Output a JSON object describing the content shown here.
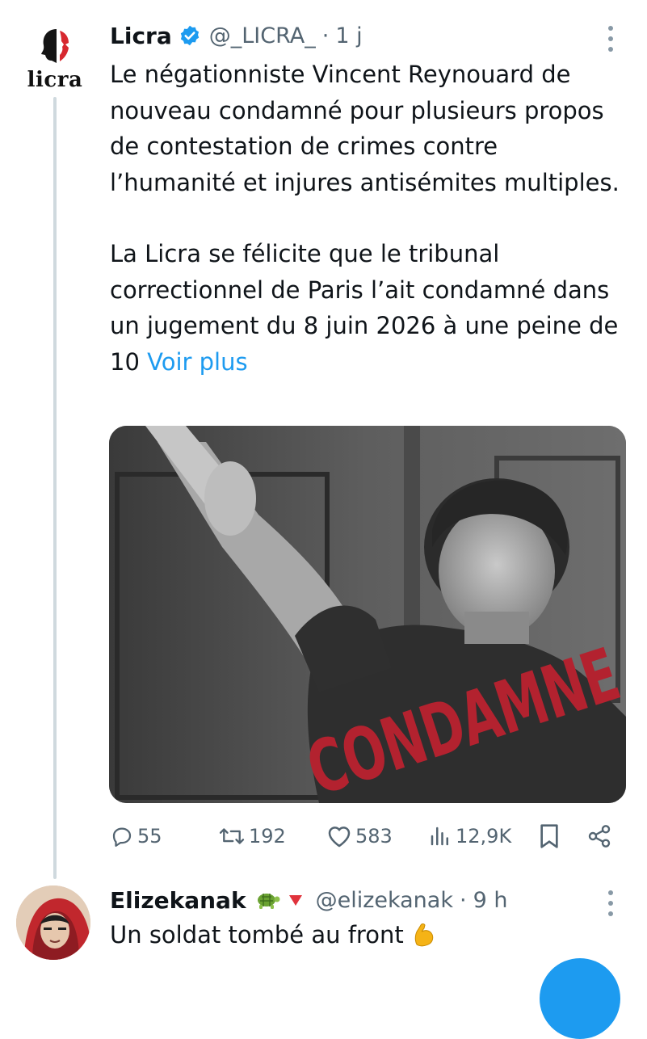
{
  "tweet": {
    "avatar_text": "licra",
    "name": "Licra",
    "handle": "@_LICRA_",
    "separator": "·",
    "time": "1 j",
    "paragraph1": "Le négationniste Vincent Reynouard de nouveau condamné pour plusieurs propos de contestation de crimes contre l’humanité et injures antisémites multiples.",
    "paragraph2": "La Licra se félicite que le tribunal correctionnel de Paris l’ait condamné dans un jugement du 8 juin 2026 à une peine de 10",
    "show_more": "Voir plus",
    "image_stamp": "CONDAMNE",
    "actions": {
      "replies": "55",
      "retweets": "192",
      "likes": "583",
      "views": "12,9K"
    }
  },
  "reply": {
    "name": "Elizekanak",
    "handle": "@elizekanak",
    "separator": "·",
    "time": "9 h",
    "text": "Un soldat tombé au front",
    "icons": [
      "turtle-emoji",
      "red-triangle-emoji",
      "flexed-biceps-emoji"
    ]
  },
  "colors": {
    "accent": "#1d9bf0",
    "muted": "#536471",
    "stamp": "#b3222f",
    "thread_line": "#cfd9de"
  }
}
